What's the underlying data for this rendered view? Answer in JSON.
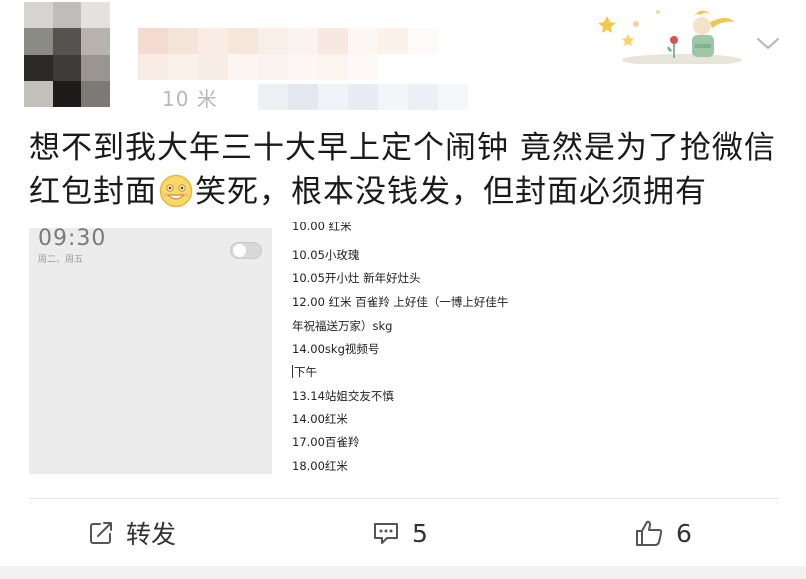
{
  "post": {
    "text_line1": "想不到我大年三十大早上定个闹钟 竟然是为了抢微信",
    "text_line2_a": "红包封面",
    "text_line2_b": "笑死，根本没钱发，但封面必须拥有",
    "emoji": "grinning-smiley-emoji"
  },
  "header": {
    "meta_partial": "10 米"
  },
  "alarm_screenshot": {
    "time": "09:30",
    "days": "周二、周五",
    "toggle_on": false
  },
  "schedule": {
    "lines": [
      "10.00 红米",
      "10.05小玫瑰",
      "10.05开小灶  新年好灶头",
      "12.00 红米 百雀羚 上好佳（一博上好佳牛",
      "年祝福送万家）skg",
      "14.00skg视频号",
      "下午",
      "13.14站姐交友不慎",
      "14.00红米",
      "17.00百雀羚",
      "18.00红米"
    ]
  },
  "actions": {
    "repost_label": "转发",
    "comment_count": "5",
    "like_count": "6"
  },
  "icons": {
    "repost": "share-arrow-icon",
    "comment": "comment-bubble-icon",
    "like": "thumbs-up-icon",
    "menu": "chevron-down-icon"
  },
  "colors": {
    "text": "#1a1a1a",
    "muted": "#b8b8b8",
    "icon": "#555555",
    "image_bg": "#ececec"
  }
}
